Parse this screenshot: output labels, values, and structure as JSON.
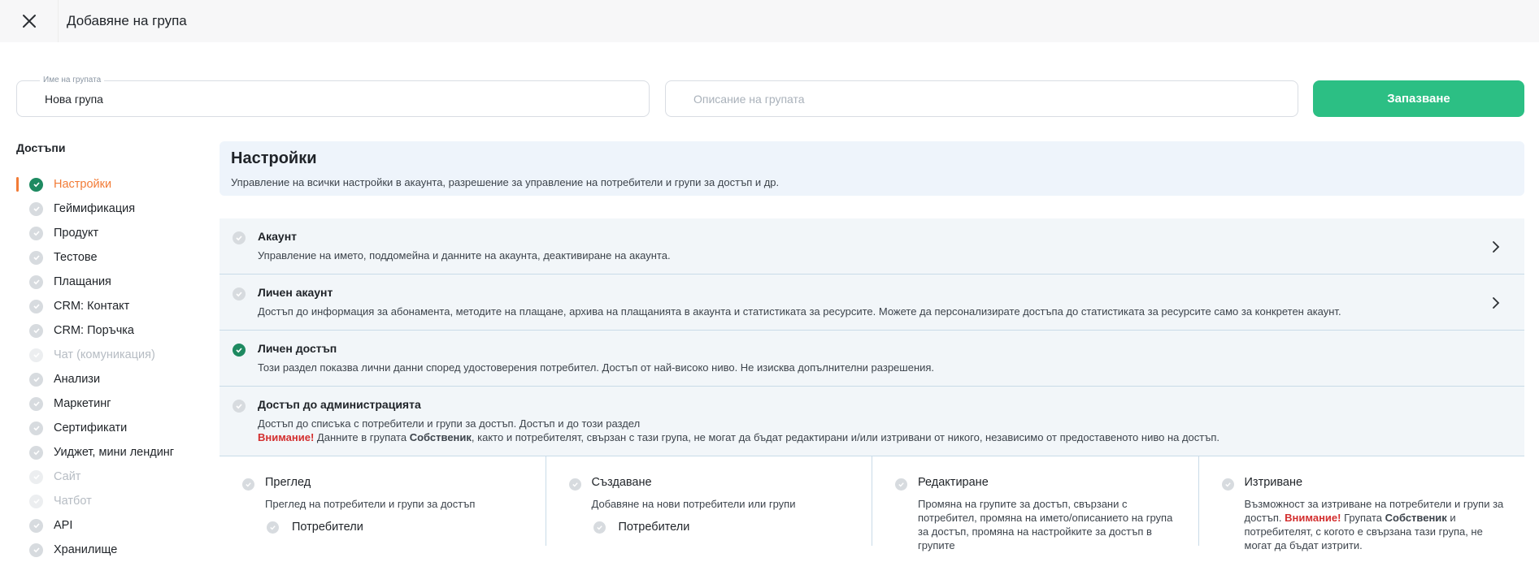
{
  "header": {
    "title": "Добавяне на група"
  },
  "form": {
    "name_label": "Име на групата",
    "name_value": "Нова група",
    "description_placeholder": "Описание на групата",
    "save_label": "Запазване"
  },
  "sidebar": {
    "title": "Достъпи",
    "items": [
      {
        "label": "Настройки",
        "state": "active"
      },
      {
        "label": "Геймификация",
        "state": "normal"
      },
      {
        "label": "Продукт",
        "state": "normal"
      },
      {
        "label": "Тестове",
        "state": "normal"
      },
      {
        "label": "Плащания",
        "state": "normal"
      },
      {
        "label": "CRM: Контакт",
        "state": "normal"
      },
      {
        "label": "CRM: Поръчка",
        "state": "normal"
      },
      {
        "label": "Чат (комуникация)",
        "state": "disabled"
      },
      {
        "label": "Анализи",
        "state": "normal"
      },
      {
        "label": "Маркетинг",
        "state": "normal"
      },
      {
        "label": "Сертификати",
        "state": "normal"
      },
      {
        "label": "Уиджет, мини лендинг",
        "state": "normal"
      },
      {
        "label": "Сайт",
        "state": "disabled"
      },
      {
        "label": "Чатбот",
        "state": "disabled"
      },
      {
        "label": "API",
        "state": "normal"
      },
      {
        "label": "Хранилище",
        "state": "normal"
      }
    ]
  },
  "main": {
    "title": "Настройки",
    "description": "Управление на всички настройки в акаунта, разрешение за управление на потребители и групи за достъп и др.",
    "sections": [
      {
        "title": "Акаунт",
        "desc": "Управление на името, поддомейна и данните на акаунта, деактивиране на акаунта."
      },
      {
        "title": "Личен акаунт",
        "desc": "Достъп до информация за абонамента, методите на плащане, архива на плащанията в акаунта и статистиката за ресурсите. Можете да персонализирате достъпа до статистиката за ресурсите само за конкретен акаунт."
      },
      {
        "title": "Личен достъп",
        "desc": "Този раздел показва лични данни според удостоверения потребител. Достъп от най-високо ниво. Не изисква допълнителни разрешения."
      },
      {
        "title": "Достъп до администрацията",
        "desc": "Достъп до списъка с потребители и групи за достъп. Достъп и до този раздел",
        "warn_label": "Внимание!",
        "warn_text_1": " Данните в групата ",
        "warn_bold": "Собственик",
        "warn_text_2": ", както и потребителят, свързан с тази група, не могат да бъдат редактирани и/или изтривани от никого, независимо от предоставеното ниво на достъп."
      }
    ],
    "permissions": [
      {
        "title": "Преглед",
        "desc": "Преглед на потребители и групи за достъп",
        "sub": "Потребители"
      },
      {
        "title": "Създаване",
        "desc": "Добавяне на нови потребители или групи",
        "sub": "Потребители"
      },
      {
        "title": "Редактиране",
        "desc": "Промяна на групите за достъп, свързани с потребител, промяна на името/описанието на група за достъп, промяна на настройките за достъп в групите"
      },
      {
        "title": "Изтриване",
        "desc_1": "Възможност за изтриване на потребители и групи за достъп. ",
        "warn_label": "Внимание!",
        "desc_2": " Групата ",
        "desc_bold": "Собственик",
        "desc_3": " и потребителят, с когото е свързана тази група, не могат да бъдат изтрити."
      }
    ]
  },
  "colors": {
    "accent": "#f27b36",
    "primary": "#2cbf84",
    "check_active": "#1e8a61"
  }
}
